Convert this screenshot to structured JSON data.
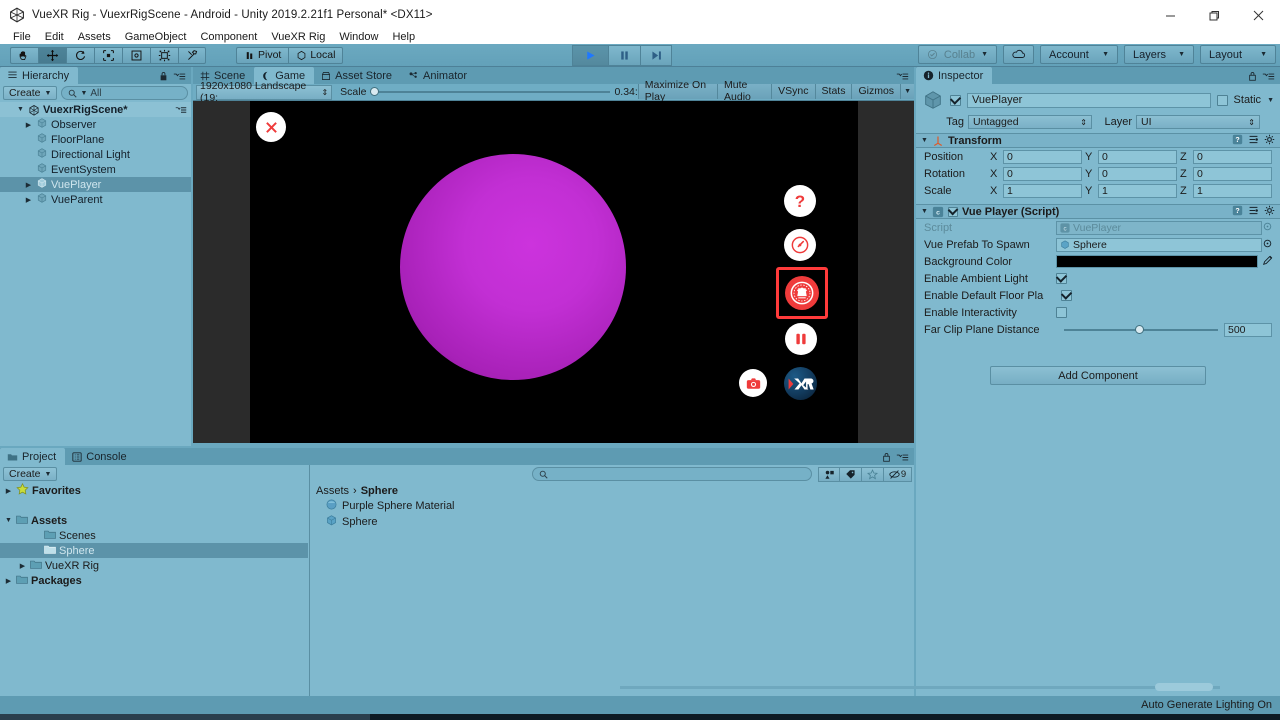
{
  "window": {
    "title": "VueXR Rig - VuexrRigScene - Android - Unity 2019.2.21f1 Personal* <DX11>",
    "minimize": "–",
    "maximize": "❐",
    "close": "✕"
  },
  "menubar": {
    "items": [
      "File",
      "Edit",
      "Assets",
      "GameObject",
      "Component",
      "VueXR Rig",
      "Window",
      "Help"
    ]
  },
  "toolbar": {
    "tools": [
      {
        "name": "hand-tool",
        "glyph": "✋",
        "active": false
      },
      {
        "name": "move-tool",
        "glyph": "✥",
        "active": true
      },
      {
        "name": "rotate-tool",
        "glyph": "⟳",
        "active": false
      },
      {
        "name": "scale-tool",
        "glyph": "⤢",
        "active": false
      },
      {
        "name": "rect-tool",
        "glyph": "▣",
        "active": false
      },
      {
        "name": "transform-tool",
        "glyph": "✢",
        "active": false
      },
      {
        "name": "custom-editor-tool",
        "glyph": "⚒",
        "active": false
      }
    ],
    "pivot_label": "Pivot",
    "local_label": "Local",
    "play_label": "▶",
    "pause_label": "❚❚",
    "step_label": "▶❙",
    "collab_label": "Collab",
    "cloud_label": "☁",
    "account_label": "Account",
    "layers_label": "Layers",
    "layout_label": "Layout"
  },
  "hierarchy": {
    "tab_label": "Hierarchy",
    "create_label": "Create",
    "search_placeholder": "All",
    "scene_name": "VuexrRigScene*",
    "items": [
      {
        "label": "Observer",
        "indent": 1,
        "expandable": true,
        "selected": false
      },
      {
        "label": "FloorPlane",
        "indent": 1,
        "expandable": false,
        "selected": false
      },
      {
        "label": "Directional Light",
        "indent": 1,
        "expandable": false,
        "selected": false
      },
      {
        "label": "EventSystem",
        "indent": 1,
        "expandable": false,
        "selected": false
      },
      {
        "label": "VuePlayer",
        "indent": 1,
        "expandable": true,
        "selected": true
      },
      {
        "label": "VueParent",
        "indent": 1,
        "expandable": true,
        "selected": false
      }
    ]
  },
  "gameview": {
    "tabs": [
      {
        "label": "Scene",
        "icon": "grid-icon",
        "active": false
      },
      {
        "label": "Game",
        "icon": "gamepad-icon",
        "active": true
      },
      {
        "label": "Asset Store",
        "icon": "store-icon",
        "active": false
      },
      {
        "label": "Animator",
        "icon": "animator-icon",
        "active": false
      }
    ],
    "aspect": "1920x1080 Landscape (19:",
    "scale_label": "Scale",
    "scale_value": "0.34:",
    "maximize_on_play": "Maximize On Play",
    "mute_audio": "Mute Audio",
    "vsync": "VSync",
    "stats": "Stats",
    "gizmos": "Gizmos",
    "overlay": {
      "close_button": "✕",
      "help_button": "?",
      "speed_button": "speedometer",
      "model_button": "emblem",
      "pause_button": "❚❚",
      "camera_button": "camera",
      "xr_logo": "XR"
    },
    "scene_object": "purple-sphere"
  },
  "inspector": {
    "tab_label": "Inspector",
    "object_name": "VuePlayer",
    "static_label": "Static",
    "tag_label": "Tag",
    "tag_value": "Untagged",
    "layer_label": "Layer",
    "layer_value": "UI",
    "transform": {
      "title": "Transform",
      "rows": [
        {
          "label": "Position",
          "x": "0",
          "y": "0",
          "z": "0"
        },
        {
          "label": "Rotation",
          "x": "0",
          "y": "0",
          "z": "0"
        },
        {
          "label": "Scale",
          "x": "1",
          "y": "1",
          "z": "1"
        }
      ],
      "axes": [
        "X",
        "Y",
        "Z"
      ]
    },
    "script_component": {
      "title": "Vue Player (Script)",
      "script_label": "Script",
      "script_value": "VuePlayer",
      "prefab_label": "Vue Prefab To Spawn",
      "prefab_value": "Sphere",
      "background_color_label": "Background Color",
      "background_color_value": "#000000",
      "ambient_light_label": "Enable Ambient Light",
      "ambient_light_checked": true,
      "floor_plane_label": "Enable Default Floor Pla",
      "floor_plane_checked": true,
      "interactivity_label": "Enable Interactivity",
      "interactivity_checked": false,
      "far_clip_label": "Far Clip Plane Distance",
      "far_clip_value": "500"
    },
    "add_component_label": "Add Component"
  },
  "project": {
    "tabs": [
      {
        "label": "Project",
        "active": true
      },
      {
        "label": "Console",
        "active": false
      }
    ],
    "create_label": "Create",
    "search_placeholder": "",
    "filter_count": "9",
    "tree": [
      {
        "label": "Favorites",
        "indent": 0,
        "icon": "star-icon",
        "expandable": true,
        "bold": true,
        "selected": false
      },
      {
        "label": "",
        "indent": 0,
        "icon": "",
        "expandable": false,
        "bold": false,
        "selected": false,
        "spacer": true
      },
      {
        "label": "Assets",
        "indent": 0,
        "icon": "folder-icon",
        "expandable": true,
        "expanded": true,
        "bold": true,
        "selected": false
      },
      {
        "label": "Scenes",
        "indent": 2,
        "icon": "folder-icon",
        "expandable": false,
        "bold": false,
        "selected": false
      },
      {
        "label": "Sphere",
        "indent": 2,
        "icon": "folder-icon",
        "expandable": false,
        "bold": false,
        "selected": true
      },
      {
        "label": "VueXR Rig",
        "indent": 1,
        "icon": "folder-icon",
        "expandable": true,
        "bold": false,
        "selected": false
      },
      {
        "label": "Packages",
        "indent": 0,
        "icon": "folder-icon",
        "expandable": true,
        "bold": true,
        "selected": false
      }
    ],
    "breadcrumb": [
      "Assets",
      "Sphere"
    ],
    "assets": [
      {
        "label": "Purple Sphere Material",
        "icon": "material-icon"
      },
      {
        "label": "Sphere",
        "icon": "prefab-icon"
      }
    ]
  },
  "statusbar": {
    "text": "Auto Generate Lighting On"
  },
  "colors": {
    "panel": "#80b9ce",
    "chrome": "#6aa8bf",
    "selection": "#5c93a9",
    "accent_red": "#ef3b3b",
    "sphere_purple": "#c22fd4",
    "xr_blue": "#123a5c"
  }
}
